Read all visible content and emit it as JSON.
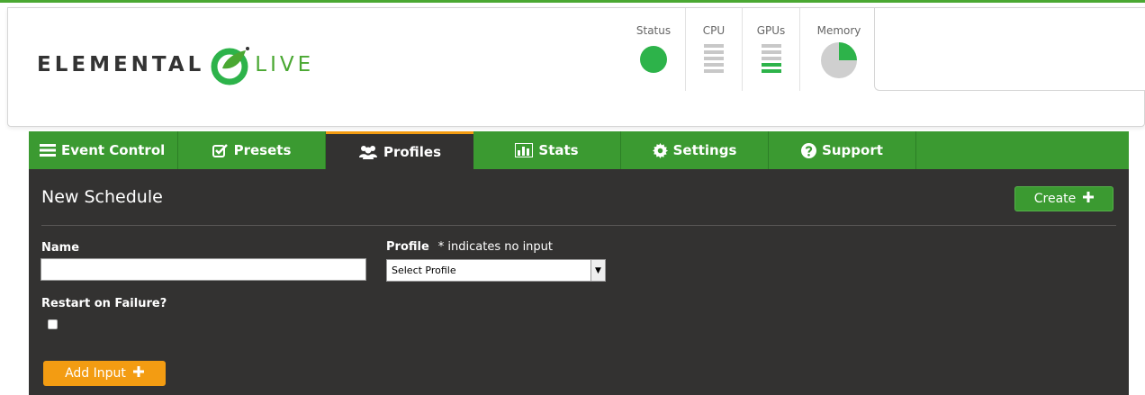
{
  "brand": {
    "name_part1": "ELEMENTAL",
    "name_part2": "LIVE",
    "accent": "#4aa832"
  },
  "monitors": [
    {
      "label": "Status",
      "icon": "status-dot-icon",
      "state": "ok"
    },
    {
      "label": "CPU",
      "icon": "cpu-bars-icon"
    },
    {
      "label": "GPUs",
      "icon": "gpu-bars-icon"
    },
    {
      "label": "Memory",
      "icon": "memory-pie-icon"
    }
  ],
  "nav": {
    "tabs": [
      {
        "label": "Event Control",
        "icon": "list-icon",
        "active": false
      },
      {
        "label": "Presets",
        "icon": "checkbox-icon",
        "active": false
      },
      {
        "label": "Profiles",
        "icon": "users-icon",
        "active": true
      },
      {
        "label": "Stats",
        "icon": "bar-chart-icon",
        "active": false
      },
      {
        "label": "Settings",
        "icon": "gear-icon",
        "active": false
      },
      {
        "label": "Support",
        "icon": "question-icon",
        "active": false
      }
    ]
  },
  "form": {
    "title": "New Schedule",
    "create_label": "Create",
    "name_label": "Name",
    "name_value": "",
    "profile_label": "Profile",
    "profile_note": "* indicates no input",
    "profile_selected": "Select Profile",
    "restart_label": "Restart on Failure?",
    "restart_checked": false,
    "add_input_label": "Add Input"
  },
  "colors": {
    "nav_green": "#3b9a31",
    "panel_dark": "#333231",
    "orange": "#f39c12",
    "status_green": "#2db34a"
  }
}
